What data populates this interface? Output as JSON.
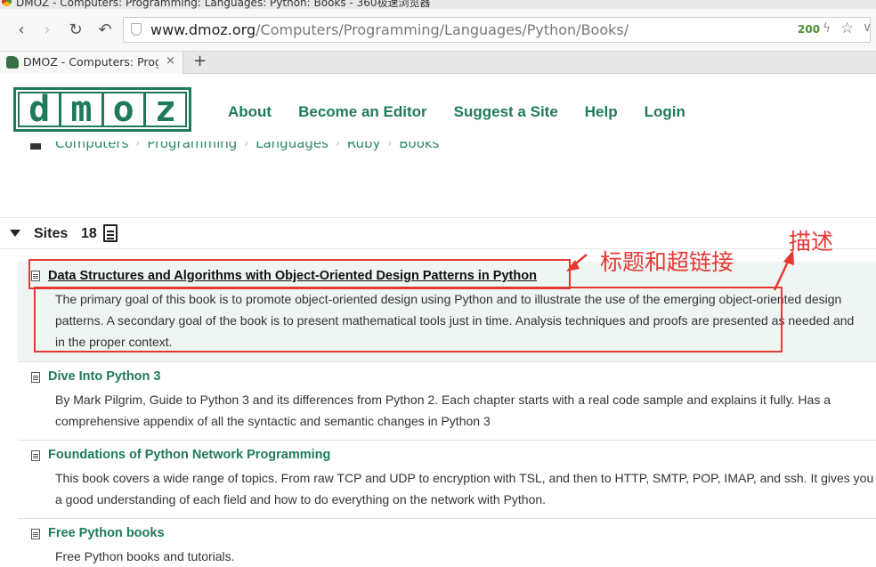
{
  "window": {
    "title": "DMOZ - Computers: Programming: Languages: Python: Books - 360极速浏览器"
  },
  "navbar": {
    "back_icon": "‹",
    "forward_icon": "›",
    "reload_icon": "↻",
    "undo_icon": "↶",
    "url_host": "www.dmoz.org",
    "url_path": "/Computers/Programming/Languages/Python/Books/",
    "speed": "200",
    "bolt_icon": "ϟ",
    "star_icon": "☆",
    "more_icon": "∨"
  },
  "tabs": [
    {
      "title": "DMOZ - Computers: Programming: Languages: Python: Books",
      "close": "×"
    }
  ],
  "new_tab": "+",
  "logo": [
    "d",
    "m",
    "o",
    "z"
  ],
  "topnav": [
    "About",
    "Become an Editor",
    "Suggest a Site",
    "Help",
    "Login"
  ],
  "breadcrumb": [
    "Computers",
    "Programming",
    "Languages",
    "Ruby",
    "Books"
  ],
  "breadcrumb_sep": "›",
  "sites": {
    "label": "Sites",
    "count": "18",
    "items": [
      {
        "title": "Data Structures and Algorithms with Object-Oriented Design Patterns in Python",
        "desc": [
          "The primary goal of this book is to promote object-oriented design using Python and to illustrate the use of the emerging object-oriented design",
          "patterns. A secondary goal of the book is to present mathematical tools just in time. Analysis techniques and proofs are presented as needed and",
          "in the proper context."
        ]
      },
      {
        "title": "Dive Into Python 3",
        "desc": [
          "By Mark Pilgrim, Guide to Python 3 and its differences from Python 2. Each chapter starts with a real code sample and explains it fully. Has a",
          "comprehensive appendix of all the syntactic and semantic changes in Python 3"
        ]
      },
      {
        "title": "Foundations of Python Network Programming",
        "desc": [
          "This book covers a wide range of topics. From raw TCP and UDP to encryption with TSL, and then to HTTP, SMTP, POP, IMAP, and ssh. It gives you",
          "a good understanding of each field and how to do everything on the network with Python."
        ]
      },
      {
        "title": "Free Python books",
        "desc": [
          "Free Python books and tutorials."
        ]
      }
    ]
  },
  "annotations": {
    "title_label": "标题和超链接",
    "desc_label": "描述",
    "color": "#e53935"
  }
}
